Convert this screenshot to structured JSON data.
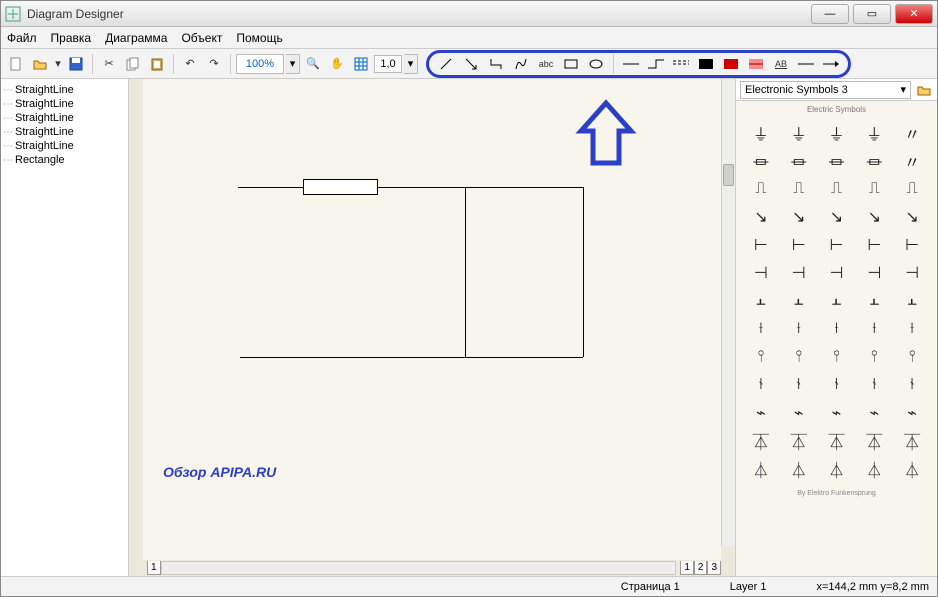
{
  "window": {
    "title": "Diagram Designer"
  },
  "menu": {
    "file": "Файл",
    "edit": "Правка",
    "diagram": "Диаграмма",
    "object": "Объект",
    "help": "Помощь"
  },
  "toolbar": {
    "zoom": "100%",
    "grid": "1,0"
  },
  "tree": {
    "items": [
      {
        "label": "StraightLine"
      },
      {
        "label": "StraightLine"
      },
      {
        "label": "StraightLine"
      },
      {
        "label": "StraightLine"
      },
      {
        "label": "StraightLine"
      },
      {
        "label": "Rectangle"
      }
    ]
  },
  "palette": {
    "selected": "Electronic Symbols 3",
    "title": "Electric Symbols",
    "footer": "By Elektro Funkensprung"
  },
  "pagetabs": {
    "left": "1",
    "t1": "1",
    "t2": "2",
    "t3": "3"
  },
  "status": {
    "page": "Страница 1",
    "layer": "Layer 1",
    "coords": "x=144,2 mm  y=8,2 mm"
  },
  "watermark": "Обзор APIPA.RU"
}
